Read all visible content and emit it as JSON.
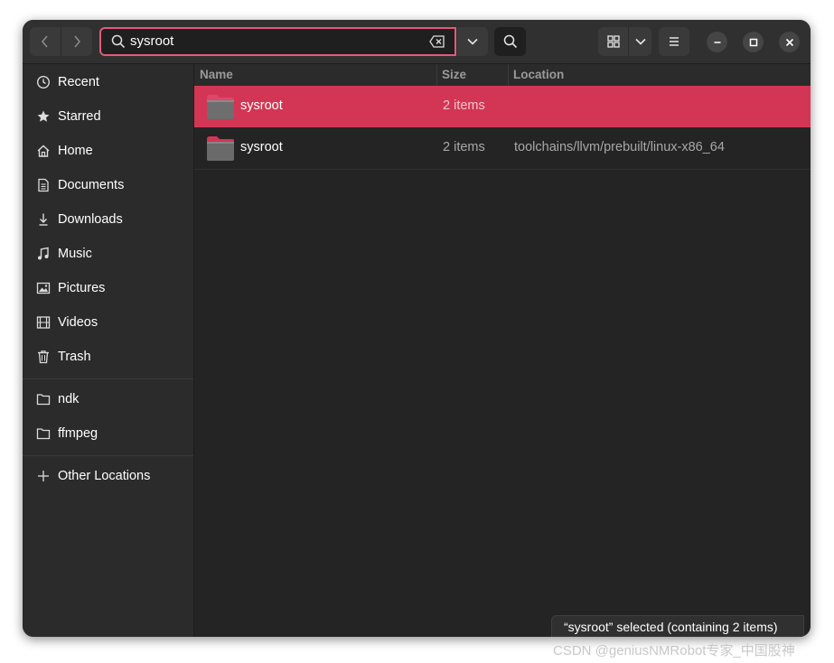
{
  "app": {
    "name": "Files"
  },
  "search": {
    "query": "sysroot"
  },
  "sidebar": {
    "items": [
      {
        "label": "Recent",
        "icon": "clock-icon"
      },
      {
        "label": "Starred",
        "icon": "star-icon"
      },
      {
        "label": "Home",
        "icon": "home-icon"
      },
      {
        "label": "Documents",
        "icon": "document-icon"
      },
      {
        "label": "Downloads",
        "icon": "download-icon"
      },
      {
        "label": "Music",
        "icon": "music-icon"
      },
      {
        "label": "Pictures",
        "icon": "picture-icon"
      },
      {
        "label": "Videos",
        "icon": "video-icon"
      },
      {
        "label": "Trash",
        "icon": "trash-icon"
      }
    ],
    "bookmarks": [
      {
        "label": "ndk",
        "icon": "folder-icon"
      },
      {
        "label": "ffmpeg",
        "icon": "folder-icon"
      }
    ],
    "other": {
      "label": "Other Locations",
      "icon": "plus-icon"
    }
  },
  "columns": {
    "name": "Name",
    "size": "Size",
    "location": "Location"
  },
  "files": [
    {
      "name": "sysroot",
      "size": "2 items",
      "location": "",
      "selected": true
    },
    {
      "name": "sysroot",
      "size": "2 items",
      "location": "toolchains/llvm/prebuilt/linux-x86_64",
      "selected": false
    }
  ],
  "status": {
    "text": "“sysroot” selected  (containing 2 items)"
  },
  "watermark": {
    "text": "CSDN @geniusNMRobot专家_中国股神"
  },
  "colors": {
    "accent": "#d23654",
    "search_border": "#e35a7a",
    "background": "#242424",
    "sidebar": "#2b2b2b"
  }
}
